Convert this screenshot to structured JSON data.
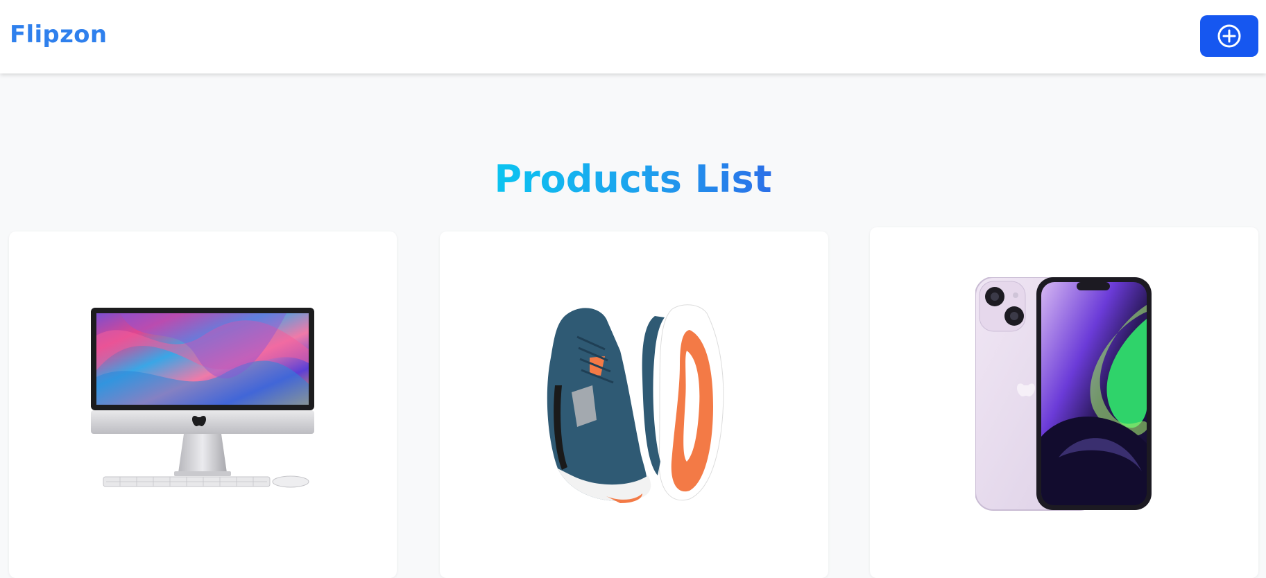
{
  "navbar": {
    "brand": "Flipzon",
    "add_button_icon": "plus-circle-icon",
    "brand_color": "#2f80ed",
    "button_color": "#1657f0"
  },
  "main": {
    "title": "Products List",
    "products": [
      {
        "image": "imac-desktop-image"
      },
      {
        "image": "running-shoes-image"
      },
      {
        "image": "iphone-purple-image"
      }
    ]
  }
}
